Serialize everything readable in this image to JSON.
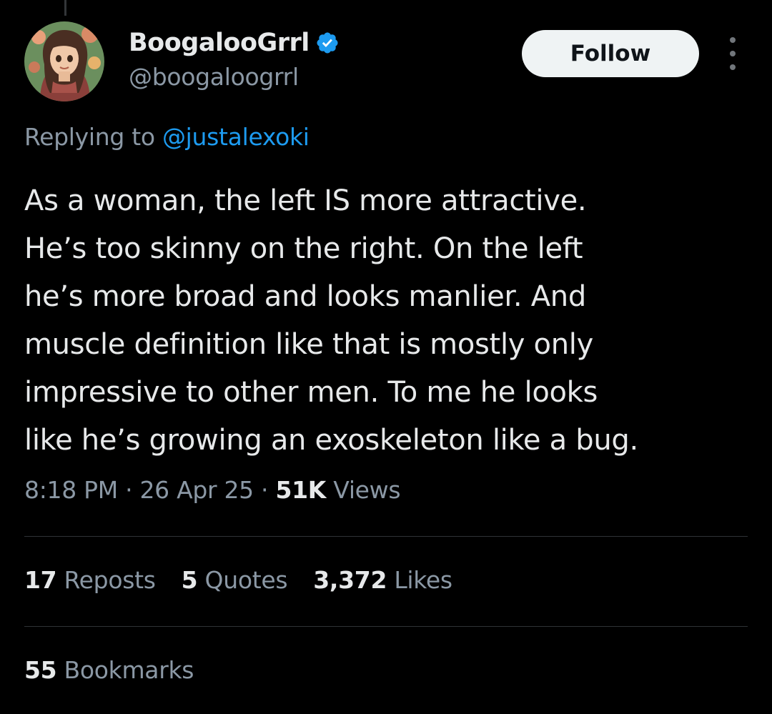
{
  "author": {
    "display_name": "BoogalooGrrl",
    "handle": "@boogaloogrrl",
    "verified": true,
    "verified_color": "#1d9bf0",
    "avatar_icon": "avatar-illustrated-woman"
  },
  "actions": {
    "follow_label": "Follow",
    "more_icon": "more-vertical-icon"
  },
  "reply": {
    "prefix": "Replying to",
    "to_handle": "@justalexoki"
  },
  "tweet": {
    "lines": [
      "As a woman, the left IS more attractive.",
      "He’s too skinny on the right. On the left",
      "he’s more broad and looks manlier. And",
      "muscle definition like that is mostly only",
      "impressive to other men. To me he looks",
      "like he’s growing an exoskeleton like a bug."
    ]
  },
  "meta": {
    "time": "8:18 PM",
    "separator": "·",
    "date": "26 Apr 25",
    "views_count": "51K",
    "views_label": "Views"
  },
  "stats": {
    "reposts_count": "17",
    "reposts_label": "Reposts",
    "quotes_count": "5",
    "quotes_label": "Quotes",
    "likes_count": "3,372",
    "likes_label": "Likes",
    "bookmarks_count": "55",
    "bookmarks_label": "Bookmarks"
  },
  "colors": {
    "background": "#000000",
    "text_primary": "#e7e9ea",
    "text_secondary": "#8b98a5",
    "link": "#1d9bf0",
    "divider": "#2f3336",
    "button_bg": "#eff3f4"
  }
}
